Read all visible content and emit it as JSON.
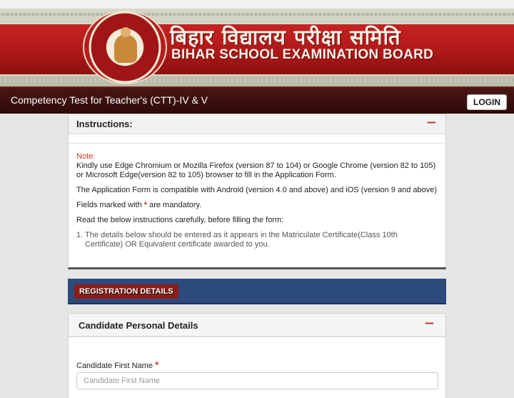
{
  "banner": {
    "hindi_title": "बिहार विद्यालय परीक्षा समिति",
    "english_title": "BIHAR SCHOOL EXAMINATION BOARD"
  },
  "navbar": {
    "title": "Competency Test for Teacher's (CTT)-IV & V",
    "login_label": "LOGIN"
  },
  "instructions": {
    "heading": "Instructions:",
    "collapse_symbol": "−",
    "note_label": "Note:",
    "note_text": "Kindly use Edge Chromium or Mozilla Firefox (version 87 to 104) or Google Chrome (version 82 to 105) or Microsoft Edge(version 82 to 105) browser to fill in the Application Form.",
    "compat_text": "The Application Form is compatible with Android (version 4.0 and above) and iOS (version 9 and above)",
    "fields_prefix": "Fields marked with ",
    "mandatory_mark": "*",
    "fields_suffix": " are mandatory.",
    "read_text": "Read the below instructions carefully, before filling the form:",
    "items": [
      "1. The details below should be entered as it appears in the Matriculate Certificate(Class 10th Certificate) OR Equivalent certificate awarded to you."
    ]
  },
  "registration": {
    "badge": "REGISTRATION DETAILS"
  },
  "personal": {
    "heading": "Candidate Personal Details",
    "collapse_symbol": "−",
    "first_name_label": "Candidate First Name",
    "mandatory_mark": "*",
    "first_name_placeholder": "Candidate First Name",
    "first_name_value": ""
  }
}
